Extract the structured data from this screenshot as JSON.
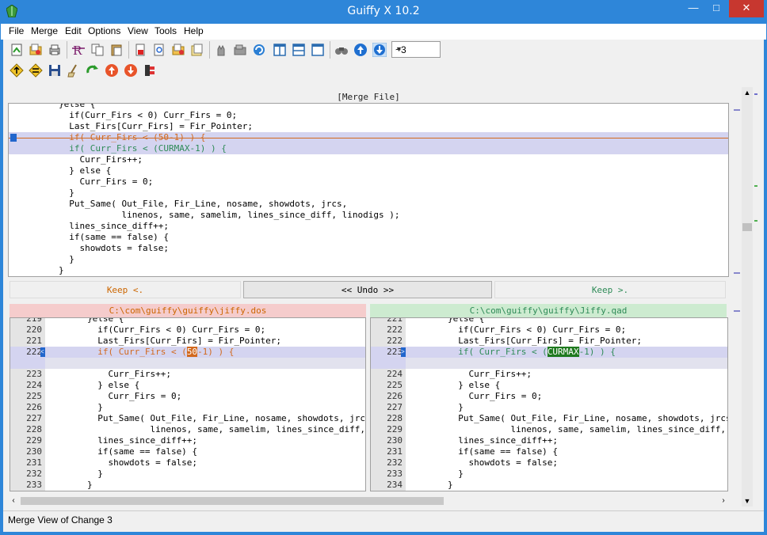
{
  "window": {
    "title": "Guiffy X 10.2"
  },
  "menu": [
    "File",
    "Merge",
    "Edit",
    "Options",
    "View",
    "Tools",
    "Help"
  ],
  "toolbar": {
    "context_value": "~3"
  },
  "merge": {
    "header": "[Merge File]",
    "lines": [
      "        }else {",
      "          if(Curr_Firs < 0) Curr_Firs = 0;",
      "          Last_Firs[Curr_Firs] = Fir_Pointer;",
      "          if( Curr_Firs < (50-1) ) {",
      "          if( Curr_Firs < (CURMAX-1) ) {",
      "            Curr_Firs++;",
      "          } else {",
      "            Curr_Firs = 0;",
      "          }",
      "          Put_Same( Out_File, Fir_Line, nosame, showdots, jrcs,",
      "                    linenos, same, samelim, lines_since_diff, linodigs );",
      "          lines_since_diff++;",
      "          if(same == false) {",
      "            showdots = false;",
      "          }",
      "        }"
    ]
  },
  "actions": {
    "keep_left": "Keep <.",
    "undo": "<< Undo >>",
    "keep_right": "Keep >."
  },
  "left": {
    "path": "C:\\com\\guiffy\\guiffy\\jiffy.dos",
    "rows": [
      {
        "n": "219",
        "t": "        }else {"
      },
      {
        "n": "220",
        "t": "          if(Curr_Firs < 0) Curr_Firs = 0;"
      },
      {
        "n": "221",
        "t": "          Last_Firs[Curr_Firs] = Fir_Pointer;"
      },
      {
        "n": "222",
        "a": "          if( Curr_Firs < (",
        "h": "50",
        "b": "-1) ) {"
      },
      {
        "n": "",
        "t": ""
      },
      {
        "n": "223",
        "t": "            Curr_Firs++;"
      },
      {
        "n": "224",
        "t": "          } else {"
      },
      {
        "n": "225",
        "t": "            Curr_Firs = 0;"
      },
      {
        "n": "226",
        "t": "          }"
      },
      {
        "n": "227",
        "t": "          Put_Same( Out_File, Fir_Line, nosame, showdots, jrcs,"
      },
      {
        "n": "228",
        "t": "                    linenos, same, samelim, lines_since_diff, linodigs );"
      },
      {
        "n": "229",
        "t": "          lines_since_diff++;"
      },
      {
        "n": "230",
        "t": "          if(same == false) {"
      },
      {
        "n": "231",
        "t": "            showdots = false;"
      },
      {
        "n": "232",
        "t": "          }"
      },
      {
        "n": "233",
        "t": "        }"
      }
    ]
  },
  "right": {
    "path": "C:\\com\\guiffy\\guiffy\\Jiffy.qad",
    "rows": [
      {
        "n": "221",
        "t": "        }else {"
      },
      {
        "n": "222",
        "t": "          if(Curr_Firs < 0) Curr_Firs = 0;"
      },
      {
        "n": "222",
        "t": "          Last_Firs[Curr_Firs] = Fir_Pointer;"
      },
      {
        "n": "223",
        "a": "          if( Curr_Firs < (",
        "h": "CURMAX",
        "b": "-1) ) {"
      },
      {
        "n": "",
        "t": ""
      },
      {
        "n": "224",
        "t": "            Curr_Firs++;"
      },
      {
        "n": "225",
        "t": "          } else {"
      },
      {
        "n": "226",
        "t": "            Curr_Firs = 0;"
      },
      {
        "n": "227",
        "t": "          }"
      },
      {
        "n": "228",
        "t": "          Put_Same( Out_File, Fir_Line, nosame, showdots, jrcs,"
      },
      {
        "n": "229",
        "t": "                    linenos, same, samelim, lines_since_diff, linodigs );"
      },
      {
        "n": "230",
        "t": "          lines_since_diff++;"
      },
      {
        "n": "231",
        "t": "          if(same == false) {"
      },
      {
        "n": "232",
        "t": "            showdots = false;"
      },
      {
        "n": "233",
        "t": "          }"
      },
      {
        "n": "234",
        "t": "        }"
      }
    ]
  },
  "status": "Merge View of Change 3",
  "colors": {
    "accent": "#2e86d9",
    "deleted": "#d2691e",
    "inserted": "#2e8b57",
    "changed_bg": "#d4d4f0",
    "left_header": "#f5cccc",
    "right_header": "#cdebd0",
    "keep_left": "#cc6600",
    "keep_right": "#2e8b57"
  }
}
